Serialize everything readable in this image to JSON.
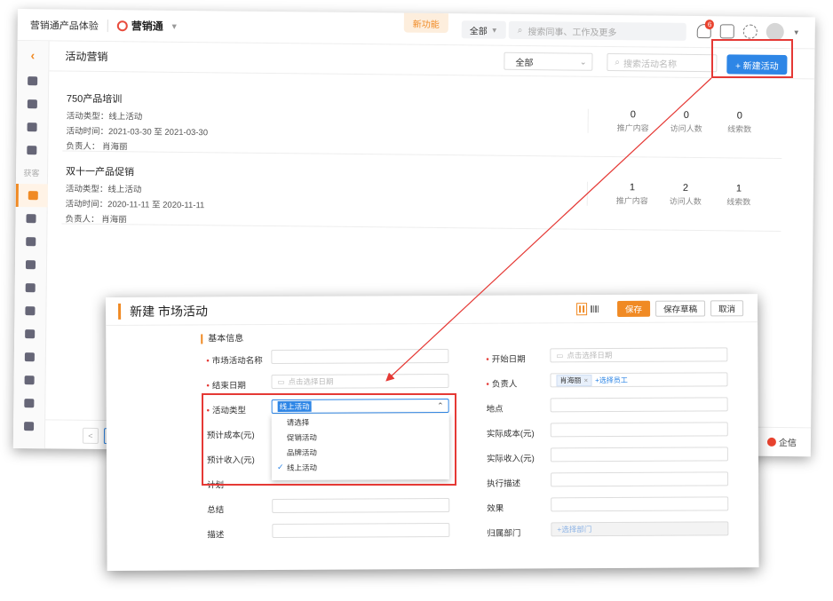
{
  "topbar": {
    "brand": "营销通产品体验",
    "product": "营销通",
    "new_feature": "新功能",
    "scope": "全部",
    "search_placeholder": "搜索同事、工作及更多",
    "notification_count": "6"
  },
  "sidebar": {
    "section_label": "获客"
  },
  "page": {
    "title": "活动营销",
    "filter": "全部",
    "search_placeholder": "搜索活动名称",
    "new_button": "+ 新建活动"
  },
  "activities": [
    {
      "name": "750产品培训",
      "type": "活动类型：线上活动",
      "time": "活动时间：2021-03-30 至 2021-03-30",
      "owner": "负责人：  肖海丽",
      "stats": [
        {
          "value": "0",
          "label": "推广内容"
        },
        {
          "value": "0",
          "label": "访问人数"
        },
        {
          "value": "0",
          "label": "线索数"
        }
      ]
    },
    {
      "name": "双十一产品促销",
      "type": "活动类型：线上活动",
      "time": "活动时间：2020-11-11 至 2020-11-11",
      "owner": "负责人：  肖海丽",
      "stats": [
        {
          "value": "1",
          "label": "推广内容"
        },
        {
          "value": "2",
          "label": "访问人数"
        },
        {
          "value": "1",
          "label": "线索数"
        }
      ]
    }
  ],
  "footer": {
    "page_prev": "<",
    "page_current": "1",
    "qixin": "企信"
  },
  "dialog": {
    "title": "新建 市场活动",
    "save": "保存",
    "save_draft": "保存草稿",
    "cancel": "取消",
    "section": "基本信息",
    "fields": {
      "name_label": "市场活动名称",
      "start_label": "开始日期",
      "start_placeholder": "点击选择日期",
      "end_label": "结束日期",
      "end_placeholder": "点击选择日期",
      "owner_label": "负责人",
      "owner_tag": "肖海丽",
      "owner_link": "+选择员工",
      "type_label": "活动类型",
      "type_value": "线上活动",
      "location_label": "地点",
      "budget_cost_label": "预计成本(元)",
      "actual_cost_label": "实际成本(元)",
      "budget_income_label": "预计收入(元)",
      "actual_income_label": "实际收入(元)",
      "plan_label": "计划",
      "exec_label": "执行描述",
      "summary_label": "总结",
      "effect_label": "效果",
      "desc_label": "描述",
      "dept_label": "归属部门",
      "dept_placeholder": "+选择部门"
    },
    "dropdown_options": [
      "请选择",
      "促销活动",
      "品牌活动",
      "线上活动"
    ]
  }
}
